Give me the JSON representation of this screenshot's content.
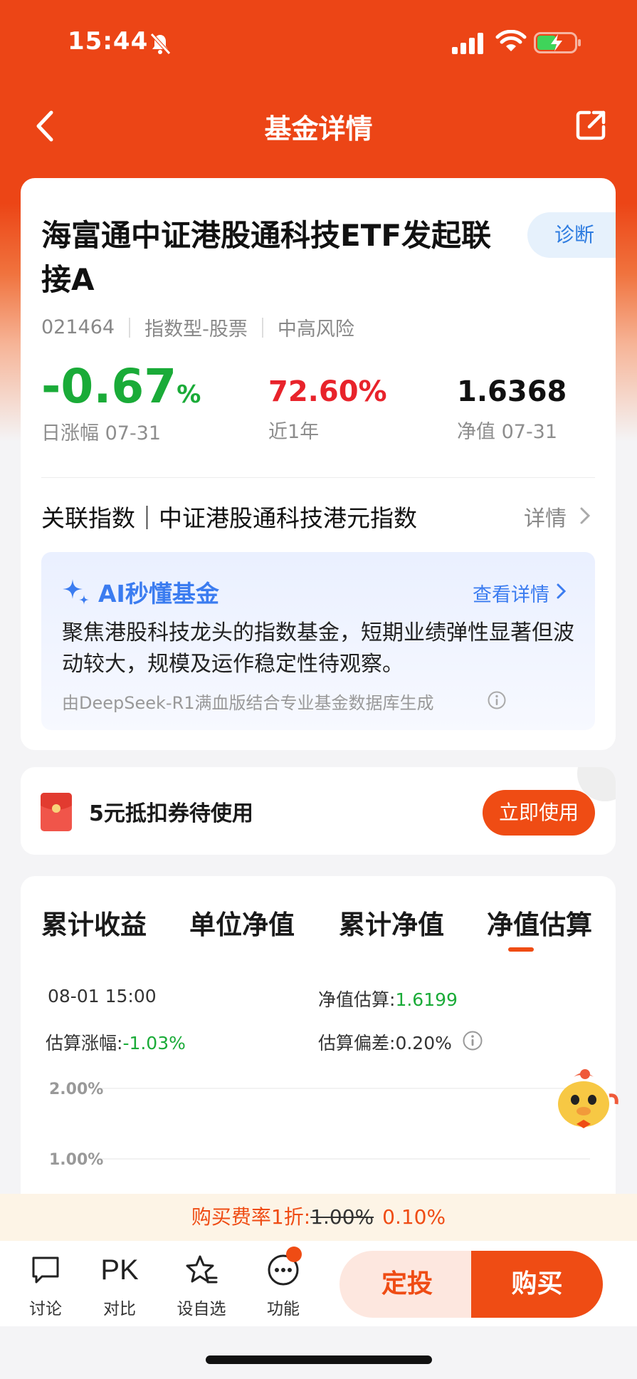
{
  "status_bar": {
    "time": "15:44"
  },
  "nav": {
    "title": "基金详情"
  },
  "fund": {
    "name": "海富通中证港股通科技ETF发起联接A",
    "diagnose_label": "诊断",
    "code": "021464",
    "type": "指数型-股票",
    "risk": "中高风险"
  },
  "stats": {
    "day_change_value": "-0.67",
    "day_change_unit": "%",
    "day_change_label": "日涨幅 07-31",
    "year_return_value": "72.60%",
    "year_return_label": "近1年",
    "nav_value": "1.6368",
    "nav_label": "净值 07-31"
  },
  "index": {
    "text": "关联指数｜中证港股通科技港元指数",
    "detail_label": "详情"
  },
  "ai": {
    "title": "AI秒懂基金",
    "more_label": "查看详情",
    "summary": "聚焦港股科技龙头的指数基金，短期业绩弹性显著但波动较大，规模及运作稳定性待观察。",
    "source": "由DeepSeek-R1满血版结合专业基金数据库生成"
  },
  "coupon": {
    "text": "5元抵扣券待使用",
    "button_label": "立即使用"
  },
  "tabs": [
    "累计收益",
    "单位净值",
    "累计净值",
    "净值估算"
  ],
  "active_tab": "净值估算",
  "estimate": {
    "time": "08-01 15:00",
    "nav_label": "净值估算:",
    "nav_value": "1.6199",
    "change_label": "估算涨幅:",
    "change_value": "-1.03%",
    "deviation_label": "估算偏差:",
    "deviation_value": "0.20%"
  },
  "chart_data": {
    "type": "line",
    "title": "",
    "xlabel": "",
    "ylabel": "",
    "y_tick_labels": [
      "2.00%",
      "1.00%"
    ],
    "y_ticks": [
      2.0,
      1.0
    ],
    "grid": true,
    "series": []
  },
  "fee": {
    "prefix": "购买费率1折:",
    "old_rate": "1.00%",
    "new_rate": "0.10%"
  },
  "bottom_bar": {
    "items": [
      {
        "label": "讨论",
        "icon": "chat-bubble-icon"
      },
      {
        "label": "对比",
        "icon": "pk-icon",
        "icon_text": "PK"
      },
      {
        "label": "设自选",
        "icon": "star-add-icon"
      },
      {
        "label": "功能",
        "icon": "more-dots-icon"
      }
    ],
    "dingtou_label": "定投",
    "buy_label": "购买"
  },
  "colors": {
    "brand": "#ec4516",
    "down_green": "#1aab38",
    "up_red": "#e8232b",
    "ai_blue": "#3b7cf0"
  }
}
